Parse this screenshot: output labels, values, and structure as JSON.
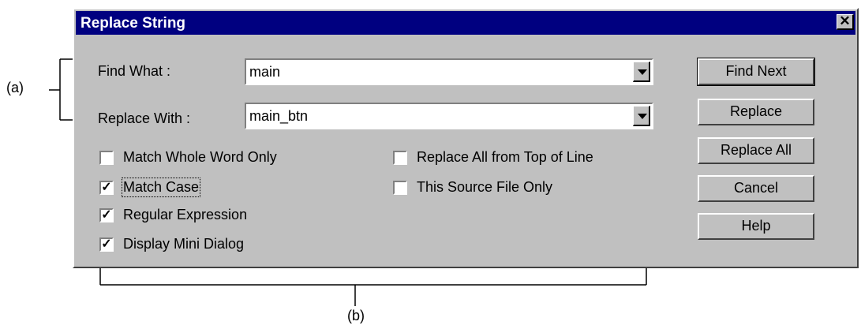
{
  "dialog": {
    "title": "Replace String",
    "close_glyph": "✕",
    "find_label": "Find What :",
    "find_value": "main",
    "replace_label": "Replace With :",
    "replace_value": "main_btn",
    "checks_left": [
      {
        "label": "Match Whole Word Only",
        "checked": false
      },
      {
        "label": "Match Case",
        "checked": true
      },
      {
        "label": "Regular Expression",
        "checked": true
      },
      {
        "label": "Display Mini Dialog",
        "checked": true
      }
    ],
    "checks_right": [
      {
        "label": "Replace All from Top of Line",
        "checked": false
      },
      {
        "label": "This Source File Only",
        "checked": false
      }
    ],
    "buttons": {
      "find_next": "Find Next",
      "replace": "Replace",
      "replace_all": "Replace All",
      "cancel": "Cancel",
      "help": "Help"
    }
  },
  "annotations": {
    "a": "(a)",
    "b": "(b)"
  },
  "check_mark": "✓",
  "colors": {
    "title_bar": "#000080",
    "dialog_face": "#c0c0c0"
  }
}
